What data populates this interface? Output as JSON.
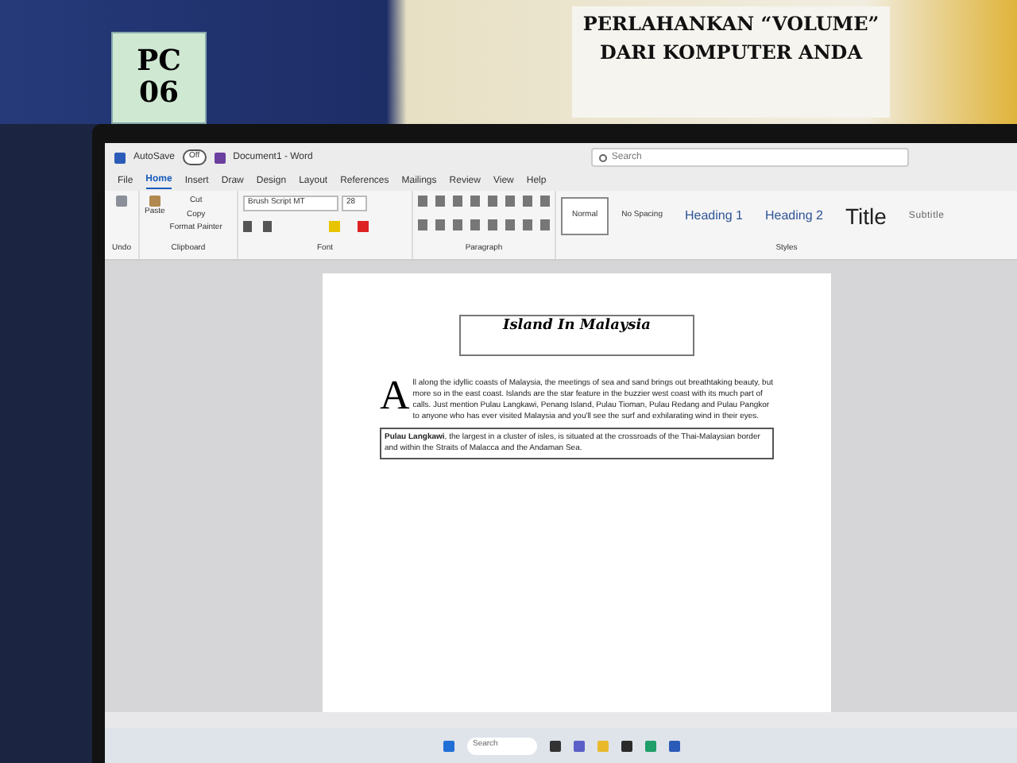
{
  "sign": {
    "label": "PC",
    "number": "06"
  },
  "poster": {
    "lines": [
      "PERLAHANKAN “VOLUME”",
      "DARI KOMPUTER ANDA"
    ]
  },
  "window": {
    "autosave": {
      "label": "AutoSave",
      "toggle": "Off",
      "on": false
    },
    "title": "Document1 - Word",
    "search": {
      "placeholder": "Search"
    }
  },
  "tabs": [
    {
      "label": "File",
      "selected": false
    },
    {
      "label": "Home",
      "selected": true
    },
    {
      "label": "Insert",
      "selected": false
    },
    {
      "label": "Draw",
      "selected": false
    },
    {
      "label": "Design",
      "selected": false
    },
    {
      "label": "Layout",
      "selected": false
    },
    {
      "label": "References",
      "selected": false
    },
    {
      "label": "Mailings",
      "selected": false
    },
    {
      "label": "Review",
      "selected": false
    },
    {
      "label": "View",
      "selected": false
    },
    {
      "label": "Help",
      "selected": false
    }
  ],
  "ribbon": {
    "clipboard": {
      "paste": "Paste",
      "cut": "Cut",
      "copy": "Copy",
      "format_painter": "Format Painter"
    },
    "font": {
      "name": "Brush Script MT",
      "size": "28"
    },
    "groups": [
      "Undo",
      "Clipboard",
      "Font",
      "Paragraph",
      "Styles"
    ],
    "styles": [
      {
        "label": "Normal",
        "selected": true
      },
      {
        "label": "No Spacing",
        "selected": false
      },
      {
        "label": "Heading 1",
        "selected": false
      },
      {
        "label": "Heading 2",
        "selected": false
      },
      {
        "label": "Title",
        "selected": false
      },
      {
        "label": "Subtitle",
        "selected": false
      }
    ]
  },
  "document": {
    "title": "Island In Malaysia",
    "drop_cap": "A",
    "paragraphs": [
      "ll along the idyllic coasts of Malaysia, the meetings of sea and sand brings out breathtaking beauty, but more so in the east coast. Islands are the star feature in the buzzier west coast with its much part of calls. Just mention Pulau Langkawi, Penang Island, Pulau Tioman, Pulau Redang and Pulau Pangkor to anyone who has ever visited Malaysia and you'll see the surf and exhilarating wind in their eyes.",
      "**Pulau Langkawi**, the largest in a cluster of isles, is situated at the crossroads of the Thai-Malaysian border and within the Straits of Malacca and the Andaman Sea."
    ]
  },
  "taskbar": {
    "search": {
      "placeholder": "Search"
    }
  }
}
